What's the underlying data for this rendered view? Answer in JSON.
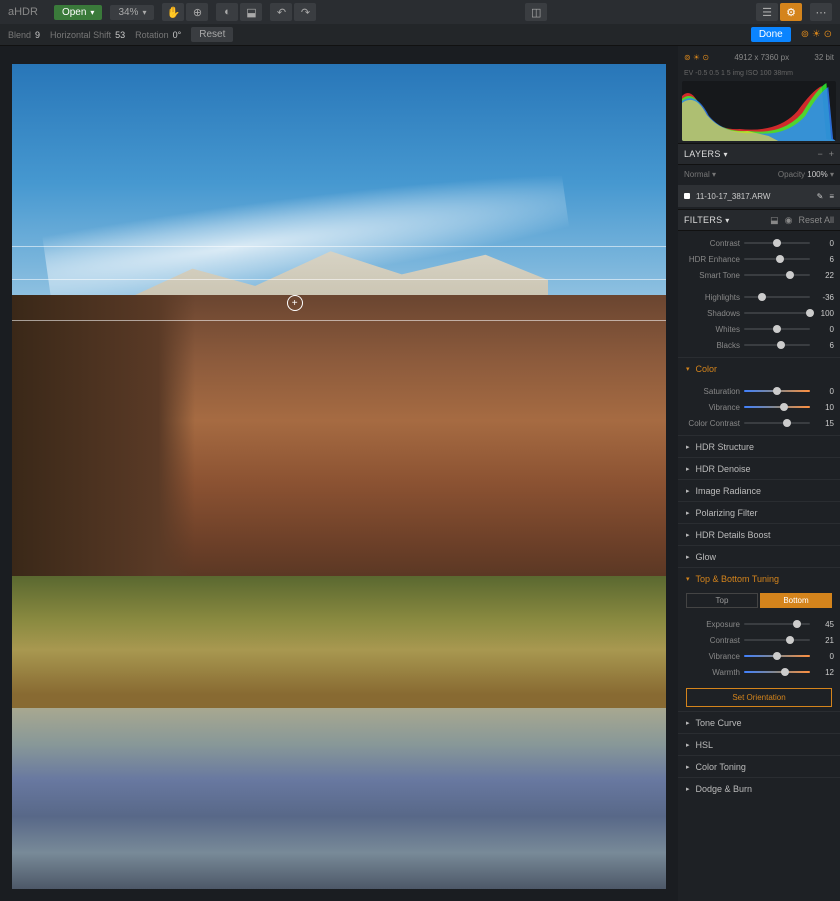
{
  "app": {
    "name": "aHDR"
  },
  "toolbar": {
    "open": "Open",
    "zoom": "34%",
    "reset": "Reset",
    "done": "Done"
  },
  "subbar": {
    "blend_label": "Blend",
    "blend_value": "9",
    "horizontal_label": "Horizontal Shift",
    "horizontal_value": "53",
    "rotation_label": "Rotation",
    "rotation_value": "0°"
  },
  "info": {
    "dimensions": "4912 x 7360 px",
    "bit_depth": "32 bit",
    "stats": "EV -0.5  0.5  1  5 img  ISO 100  38mm"
  },
  "layers": {
    "title": "LAYERS",
    "blend_mode": "Normal",
    "opacity_label": "Opacity",
    "opacity_value": "100%",
    "layer_name": "11-10-17_3817.ARW"
  },
  "filters": {
    "title": "FILTERS",
    "reset_all": "Reset All",
    "basic": {
      "contrast": {
        "label": "Contrast",
        "value": "0",
        "pos": 50
      },
      "hdr_enhance": {
        "label": "HDR Enhance",
        "value": "6",
        "pos": 55
      },
      "smart_tone": {
        "label": "Smart Tone",
        "value": "22",
        "pos": 70
      },
      "highlights": {
        "label": "Highlights",
        "value": "-36",
        "pos": 28
      },
      "shadows": {
        "label": "Shadows",
        "value": "100",
        "pos": 100
      },
      "whites": {
        "label": "Whites",
        "value": "0",
        "pos": 50
      },
      "blacks": {
        "label": "Blacks",
        "value": "6",
        "pos": 56
      }
    },
    "groups": {
      "color": {
        "title": "Color",
        "expanded": true,
        "saturation": {
          "label": "Saturation",
          "value": "0",
          "pos": 50
        },
        "vibrance": {
          "label": "Vibrance",
          "value": "10",
          "pos": 60
        },
        "color_contrast": {
          "label": "Color Contrast",
          "value": "15",
          "pos": 65
        }
      },
      "hdr_structure": {
        "title": "HDR Structure"
      },
      "hdr_denoise": {
        "title": "HDR Denoise"
      },
      "image_radiance": {
        "title": "Image Radiance"
      },
      "polarizing": {
        "title": "Polarizing Filter"
      },
      "details_boost": {
        "title": "HDR Details Boost"
      },
      "glow": {
        "title": "Glow"
      },
      "top_bottom": {
        "title": "Top & Bottom Tuning",
        "expanded": true,
        "tabs": {
          "top": "Top",
          "bottom": "Bottom"
        },
        "exposure": {
          "label": "Exposure",
          "value": "45",
          "pos": 80
        },
        "contrast": {
          "label": "Contrast",
          "value": "21",
          "pos": 70
        },
        "vibrance": {
          "label": "Vibrance",
          "value": "0",
          "pos": 50
        },
        "warmth": {
          "label": "Warmth",
          "value": "12",
          "pos": 62
        },
        "orientation": "Set Orientation"
      },
      "tone_curve": {
        "title": "Tone Curve"
      },
      "hsl": {
        "title": "HSL"
      },
      "color_toning": {
        "title": "Color Toning"
      },
      "dodge_burn": {
        "title": "Dodge & Burn"
      }
    }
  }
}
